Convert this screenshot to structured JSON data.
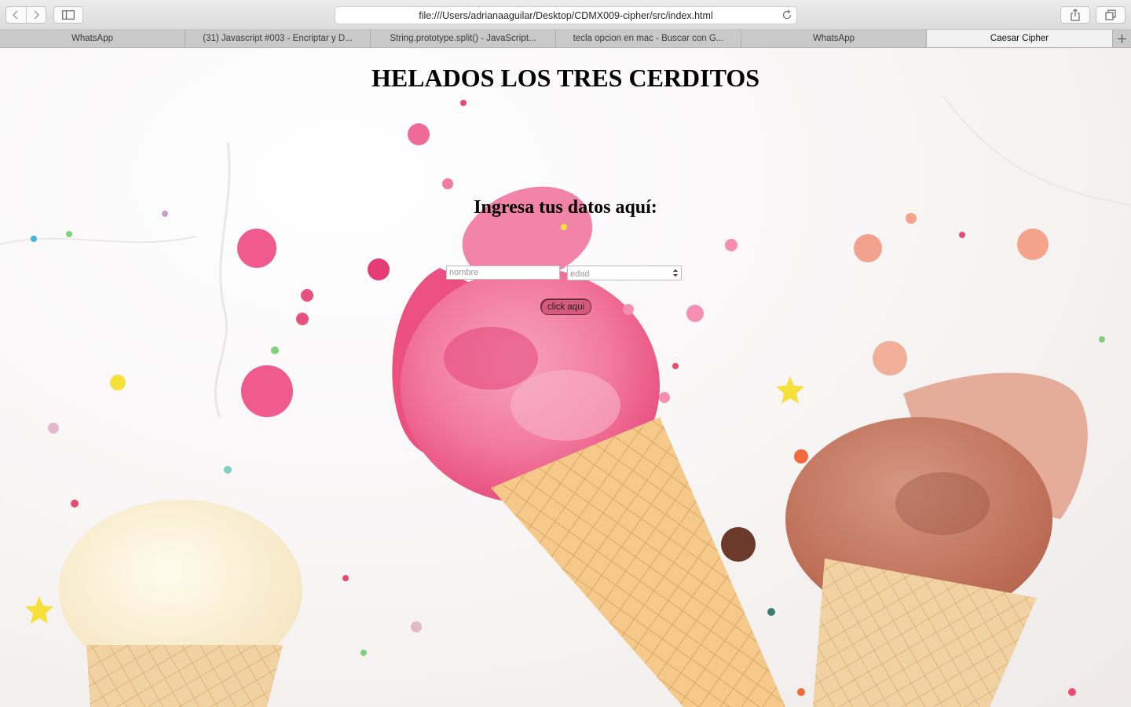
{
  "browser": {
    "url": "file:///Users/adrianaaguilar/Desktop/CDMX009-cipher/src/index.html",
    "tabs": [
      {
        "title": "WhatsApp",
        "active": false
      },
      {
        "title": "(31) Javascript #003 - Encriptar y D...",
        "active": false
      },
      {
        "title": "String.prototype.split() - JavaScript...",
        "active": false
      },
      {
        "title": "tecla opcion en mac - Buscar con G...",
        "active": false
      },
      {
        "title": "WhatsApp",
        "active": false
      },
      {
        "title": "Caesar Cipher",
        "active": true
      }
    ],
    "icons": {
      "back": "chevron-left-icon",
      "forward": "chevron-right-icon",
      "sidebar": "sidebar-icon",
      "reload": "reload-icon",
      "share": "share-icon",
      "tabs_overview": "tabs-overview-icon",
      "new_tab": "plus-icon"
    }
  },
  "page": {
    "title": "HELADOS LOS TRES CERDITOS",
    "form_heading": "Ingresa tus datos aquí:",
    "name_placeholder": "nombre",
    "age_placeholder": "edad",
    "submit_label": "click aqui",
    "colors": {
      "button": "#d65a7d",
      "text": "#000000"
    }
  }
}
